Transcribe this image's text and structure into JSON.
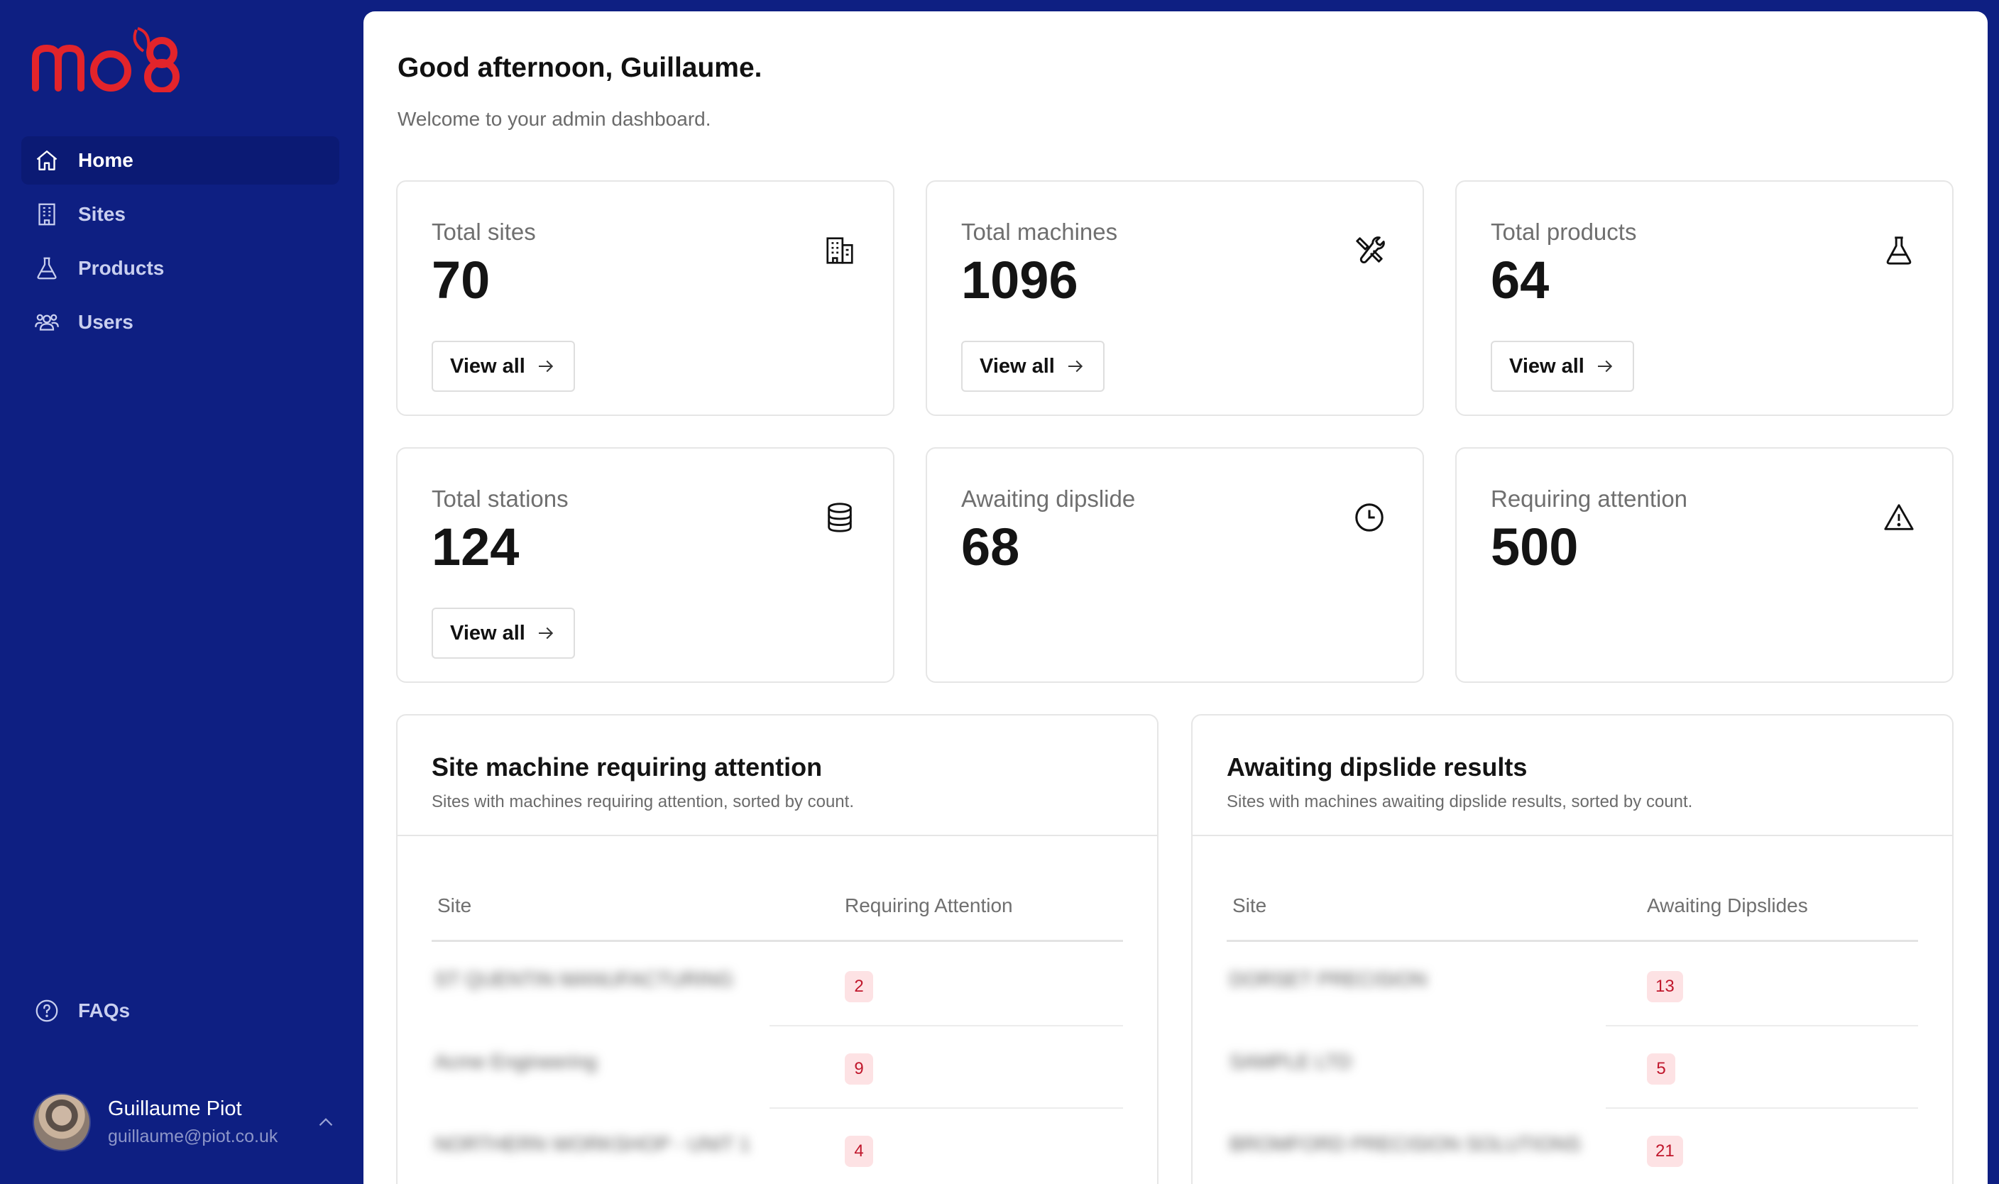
{
  "brand": {
    "logo_text": "mo8",
    "logo_color": "#e3242b",
    "sidebar_bg": "#0e1f82"
  },
  "sidebar": {
    "items": [
      {
        "label": "Home",
        "icon": "home-icon",
        "active": true
      },
      {
        "label": "Sites",
        "icon": "building-icon",
        "active": false
      },
      {
        "label": "Products",
        "icon": "flask-icon",
        "active": false
      },
      {
        "label": "Users",
        "icon": "users-icon",
        "active": false
      }
    ],
    "faq": {
      "label": "FAQs",
      "icon": "help-circle-icon"
    },
    "user": {
      "name": "Guillaume Piot",
      "email": "guillaume@piot.co.uk"
    }
  },
  "header": {
    "greeting": "Good afternoon, Guillaume.",
    "subtitle": "Welcome to your admin dashboard."
  },
  "stats": [
    {
      "label": "Total sites",
      "value": "70",
      "icon": "building-icon",
      "button": "View all"
    },
    {
      "label": "Total machines",
      "value": "1096",
      "icon": "tools-icon",
      "button": "View all"
    },
    {
      "label": "Total products",
      "value": "64",
      "icon": "flask-icon",
      "button": "View all"
    },
    {
      "label": "Total stations",
      "value": "124",
      "icon": "database-icon",
      "button": "View all"
    },
    {
      "label": "Awaiting dipslide",
      "value": "68",
      "icon": "clock-icon"
    },
    {
      "label": "Requiring attention",
      "value": "500",
      "icon": "warning-icon"
    }
  ],
  "tables": {
    "attention": {
      "title": "Site machine requiring attention",
      "subtitle": "Sites with machines requiring attention, sorted by count.",
      "columns": [
        "Site",
        "Requiring Attention"
      ],
      "rows": [
        {
          "site": "ST QUENTIN MANUFACTURING",
          "count": "2"
        },
        {
          "site": "Acme Engineering",
          "count": "9"
        },
        {
          "site": "NORTHERN WORKSHOP - UNIT 1",
          "count": "4"
        }
      ]
    },
    "dipslide": {
      "title": "Awaiting dipslide results",
      "subtitle": "Sites with machines awaiting dipslide results, sorted by count.",
      "columns": [
        "Site",
        "Awaiting Dipslides"
      ],
      "rows": [
        {
          "site": "DORSET PRECISION",
          "count": "13"
        },
        {
          "site": "SAMPLE LTD",
          "count": "5"
        },
        {
          "site": "BROMFORD PRECISION SOLUTIONS",
          "count": "21"
        }
      ]
    }
  }
}
